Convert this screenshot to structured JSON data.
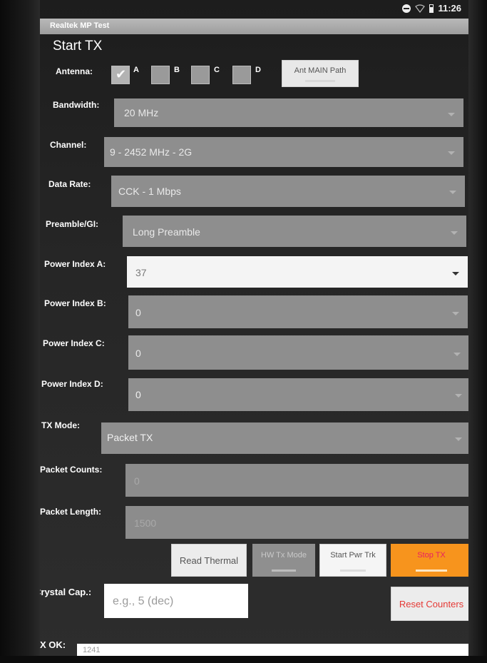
{
  "status_bar": {
    "time": "11:26"
  },
  "app_title": "Realtek MP Test",
  "section_title": "Start TX",
  "antenna": {
    "label": "Antenna:",
    "options": [
      {
        "label": "A",
        "checked": true
      },
      {
        "label": "B",
        "checked": false
      },
      {
        "label": "C",
        "checked": false
      },
      {
        "label": "D",
        "checked": false
      }
    ],
    "path_button": "Ant MAIN Path"
  },
  "bandwidth": {
    "label": "Bandwidth:",
    "value": "20 MHz"
  },
  "channel": {
    "label": "Channel:",
    "value": "9 - 2452 MHz - 2G"
  },
  "data_rate": {
    "label": "Data Rate:",
    "value": "CCK - 1 Mbps"
  },
  "preamble": {
    "label": "Preamble/GI:",
    "value": "Long Preamble"
  },
  "power_a": {
    "label": "Power Index A:",
    "value": "37"
  },
  "power_b": {
    "label": "Power Index B:",
    "value": "0"
  },
  "power_c": {
    "label": "Power Index C:",
    "value": "0"
  },
  "power_d": {
    "label": "Power Index D:",
    "value": "0"
  },
  "tx_mode": {
    "label": "TX Mode:",
    "value": "Packet TX"
  },
  "packet_counts": {
    "label": "Packet Counts:",
    "value": "0"
  },
  "packet_length": {
    "label": "Packet Length:",
    "value": "1500"
  },
  "buttons": {
    "read_thermal": "Read Thermal",
    "hw_tx_mode": "HW Tx Mode",
    "start_pwr_trk": "Start Pwr Trk",
    "stop_tx": "Stop TX",
    "reset_counters": "Reset Counters"
  },
  "crystal_cap": {
    "label": "Crystal Cap.:",
    "placeholder": "e.g., 5 (dec)"
  },
  "tx_ok": {
    "label": "TX OK:",
    "value": "1241"
  },
  "colors": {
    "accent_orange": "#f7941d",
    "danger_red": "#e53935",
    "primary": "#ffffff"
  }
}
